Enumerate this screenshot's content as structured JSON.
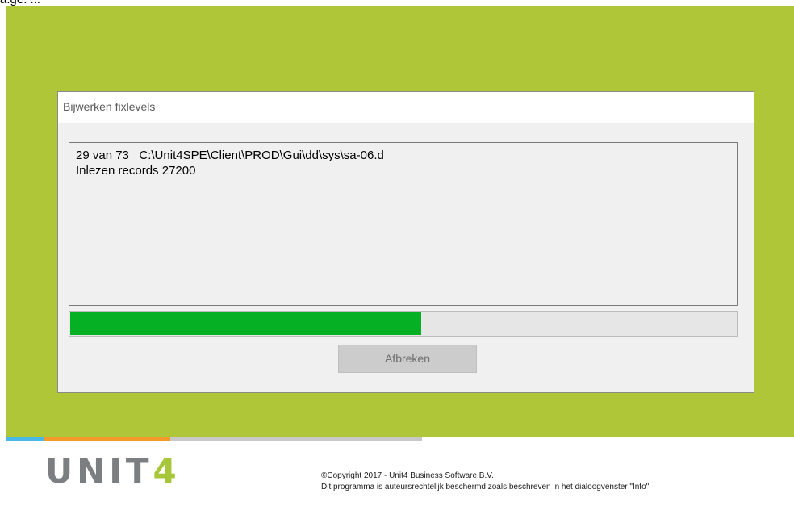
{
  "colors": {
    "background_green": "#aec638",
    "stripe_blue": "#4ab8e6",
    "stripe_orange": "#f39a2b",
    "stripe_gray": "#c8c8c8",
    "progress_green": "#06b025",
    "logo_gray": "#7c7f82",
    "logo_green": "#a8c63a"
  },
  "top_strip": {
    "text": "a.ge. ..."
  },
  "dialog": {
    "title": "Bijwerken fixlevels",
    "log_lines": [
      "29 van 73   C:\\Unit4SPE\\Client\\PROD\\Gui\\dd\\sys\\sa-06.d",
      "Inlezen records 27200"
    ],
    "progress_fraction": 0.527,
    "cancel_label": "Afbreken"
  },
  "footer": {
    "logo_text": "UNIT",
    "logo_digit": "4",
    "copyright_line1": "©Copyright 2017 - Unit4 Business Software B.V.",
    "copyright_line2": "Dit programma is auteursrechtelijk beschermd zoals beschreven in het dialoogvenster \"Info\"."
  }
}
